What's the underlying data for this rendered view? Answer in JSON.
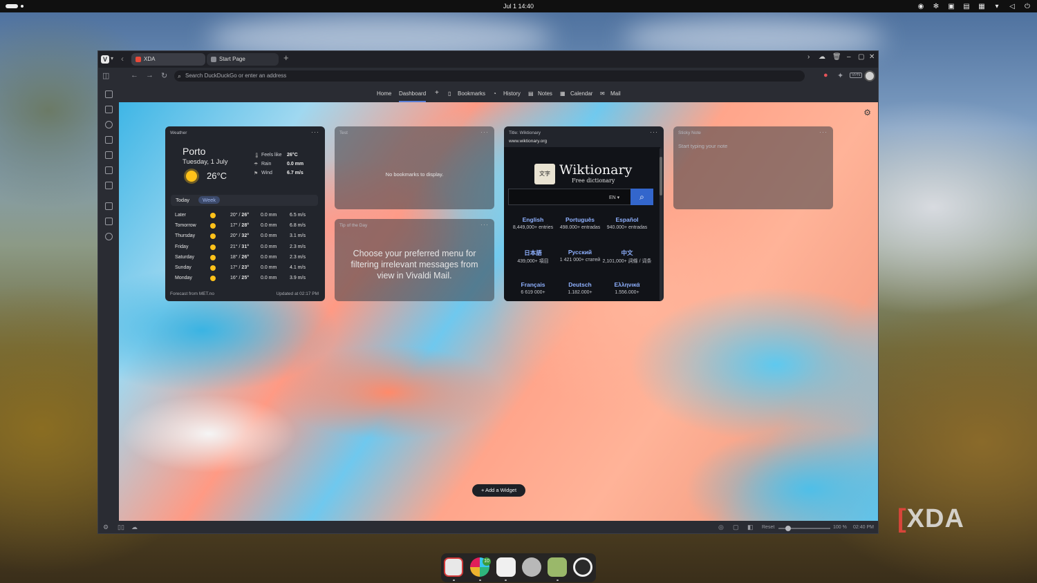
{
  "system": {
    "clock": "Jul 1  14:40"
  },
  "browser": {
    "tabs": [
      {
        "label": "XDA",
        "favicon_color": "#e84a3a"
      },
      {
        "label": "Start Page",
        "favicon_color": "#8a8c93"
      }
    ],
    "address_placeholder": "Search DuckDuckGo or enter an address",
    "vpn_label": "VPN"
  },
  "nav": {
    "home": "Home",
    "dashboard": "Dashboard",
    "add": "+",
    "bookmarks": "Bookmarks",
    "history": "History",
    "notes": "Notes",
    "calendar": "Calendar",
    "mail": "Mail"
  },
  "weather": {
    "header": "Weather",
    "city": "Porto",
    "date": "Tuesday, 1 July",
    "temp": "26°C",
    "feels_label": "Feels like",
    "feels_value": "26°C",
    "rain_label": "Rain",
    "rain_value": "0.0 mm",
    "wind_label": "Wind",
    "wind_value": "6.7 m/s",
    "tab_today": "Today",
    "tab_week": "Week",
    "forecast": [
      {
        "day": "Later",
        "lo": "20° / ",
        "hi": "26°",
        "rain": "0.0 mm",
        "wind": "6.5 m/s"
      },
      {
        "day": "Tomorrow",
        "lo": "17° / ",
        "hi": "28°",
        "rain": "0.0 mm",
        "wind": "6.8 m/s"
      },
      {
        "day": "Thursday",
        "lo": "20° / ",
        "hi": "32°",
        "rain": "0.0 mm",
        "wind": "3.1 m/s"
      },
      {
        "day": "Friday",
        "lo": "21° / ",
        "hi": "31°",
        "rain": "0.0 mm",
        "wind": "2.3 m/s"
      },
      {
        "day": "Saturday",
        "lo": "18° / ",
        "hi": "26°",
        "rain": "0.0 mm",
        "wind": "2.3 m/s"
      },
      {
        "day": "Sunday",
        "lo": "17° / ",
        "hi": "23°",
        "rain": "0.0 mm",
        "wind": "4.1 m/s"
      },
      {
        "day": "Monday",
        "lo": "16° / ",
        "hi": "25°",
        "rain": "0.0 mm",
        "wind": "3.9 m/s"
      }
    ],
    "footer_source": "Forecast from MET.no",
    "footer_updated": "Updated at 02:17 PM"
  },
  "bookmarks_widget": {
    "header": "Test",
    "empty_text": "No bookmarks to display."
  },
  "tip_widget": {
    "header": "Tip of the Day",
    "text": "Choose your preferred menu for filtering irrelevant messages from view in Vivaldi Mail."
  },
  "wiktionary": {
    "header": "Title: Wiktionary",
    "url": "www.wiktionary.org",
    "logo_text": "文字",
    "title": "Wiktionary",
    "subtitle": "Free dictionary",
    "lang_select": "EN",
    "languages": [
      {
        "name": "English",
        "count": "8,449,000+ entries"
      },
      {
        "name": "Português",
        "count": "498.000+ entradas"
      },
      {
        "name": "Español",
        "count": "940.000+ entradas"
      },
      {
        "name": "日本語",
        "count": "439,000+ 項目"
      },
      {
        "name": "Русский",
        "count": "1 421 000+ статей"
      },
      {
        "name": "中文",
        "count": "2,101,000+ 詞條 / 词条"
      },
      {
        "name": "Français",
        "count": "6 619 000+"
      },
      {
        "name": "Deutsch",
        "count": "1.182.000+"
      },
      {
        "name": "Ελληνικά",
        "count": "1.556.000+"
      }
    ]
  },
  "sticky": {
    "header": "Sticky Note",
    "placeholder": "Start typing your note"
  },
  "add_widget": "+  Add a Widget",
  "statusbar": {
    "reset": "Reset",
    "zoom": "100 %",
    "time": "02:40 PM"
  },
  "dock": {
    "badge": "10"
  },
  "watermark": "XDA"
}
